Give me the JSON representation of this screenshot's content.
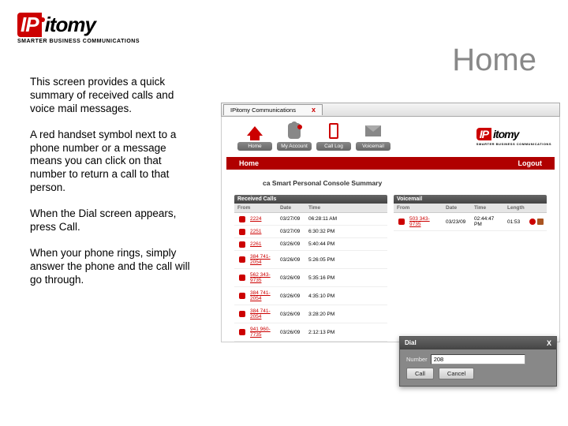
{
  "logo": {
    "ip": "IP",
    "itomy": "itomy",
    "tagline": "SMARTER BUSINESS COMMUNICATIONS"
  },
  "page_title": "Home",
  "paragraphs": [
    "This screen provides a quick summary of received calls and voice mail messages.",
    "A red handset symbol next to a phone number or a message means you can click on that number to return a call to that person.",
    "When the Dial screen appears, press Call.",
    "When your phone rings, simply answer the phone and the call will go through."
  ],
  "browser": {
    "tab_label": "IPitomy Communications",
    "tab_close": "x"
  },
  "nav": {
    "items": [
      {
        "label": "Home"
      },
      {
        "label": "My Account"
      },
      {
        "label": "Call Log"
      },
      {
        "label": "Voicemail"
      }
    ]
  },
  "redbar": {
    "left": "Home",
    "right": "Logout"
  },
  "summary_title": "ca Smart Personal Console Summary",
  "received_calls": {
    "title": "Received Calls",
    "cols": [
      "From",
      "Date",
      "Time"
    ],
    "rows": [
      {
        "num": "2224",
        "date": "03/27/09",
        "time": "06:28:11 AM"
      },
      {
        "num": "2251",
        "date": "03/27/09",
        "time": "6:30:32 PM"
      },
      {
        "num": "2261",
        "date": "03/26/09",
        "time": "5:40:44 PM"
      },
      {
        "num": "384 741-2054",
        "date": "03/26/09",
        "time": "5:26:05 PM"
      },
      {
        "num": "562 343-9735",
        "date": "03/26/09",
        "time": "5:35:16 PM"
      },
      {
        "num": "384 741-2054",
        "date": "03/26/09",
        "time": "4:35:10 PM"
      },
      {
        "num": "384 741-2054",
        "date": "03/26/09",
        "time": "3:28:20 PM"
      },
      {
        "num": "941 960-7735",
        "date": "03/26/09",
        "time": "2:12:13 PM"
      }
    ]
  },
  "voicemail": {
    "title": "Voicemail",
    "cols": [
      "From",
      "Date",
      "Time",
      "Length",
      ""
    ],
    "rows": [
      {
        "num": "503 343-9735",
        "date": "03/23/09",
        "time": "02:44:47 PM",
        "len": "01:53"
      }
    ]
  },
  "dial": {
    "title": "Dial",
    "close": "X",
    "number_label": "Number",
    "number_value": "208",
    "call": "Call",
    "cancel": "Cancel"
  }
}
